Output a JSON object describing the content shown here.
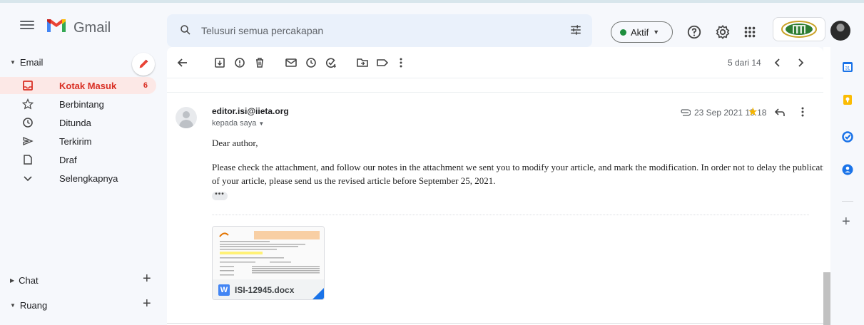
{
  "app": {
    "name": "Gmail"
  },
  "search": {
    "placeholder": "Telusuri semua percakapan"
  },
  "status": {
    "label": "Aktif",
    "color": "#1e8e3e"
  },
  "sidebar": {
    "email_header": "Email",
    "items": [
      {
        "label": "Kotak Masuk",
        "count": "6",
        "icon": "inbox-icon"
      },
      {
        "label": "Berbintang",
        "icon": "star-icon"
      },
      {
        "label": "Ditunda",
        "icon": "clock-icon"
      },
      {
        "label": "Terkirim",
        "icon": "send-icon"
      },
      {
        "label": "Draf",
        "icon": "draft-icon"
      },
      {
        "label": "Selengkapnya",
        "icon": "chevron-down-icon"
      }
    ],
    "chat_header": "Chat",
    "ruang_header": "Ruang"
  },
  "toolbar": {
    "pager": "5 dari 14"
  },
  "message": {
    "sender": "editor.isi@iieta.org",
    "to": "kepada saya",
    "date": "23 Sep 2021 15.18",
    "greeting": "Dear author,",
    "body_line1": "Please check the attachment, and follow our notes in the attachment we sent you to modify your article, and mark the modification. In order not to delay the publication",
    "body_line2": "of your article, please send us the revised article before September 25, 2021.",
    "attachment": {
      "name": "ISI-12945.docx",
      "type_letter": "W"
    }
  },
  "colors": {
    "accent": "#d93025",
    "active_bg": "#fce8e6",
    "star": "#f4b400"
  }
}
